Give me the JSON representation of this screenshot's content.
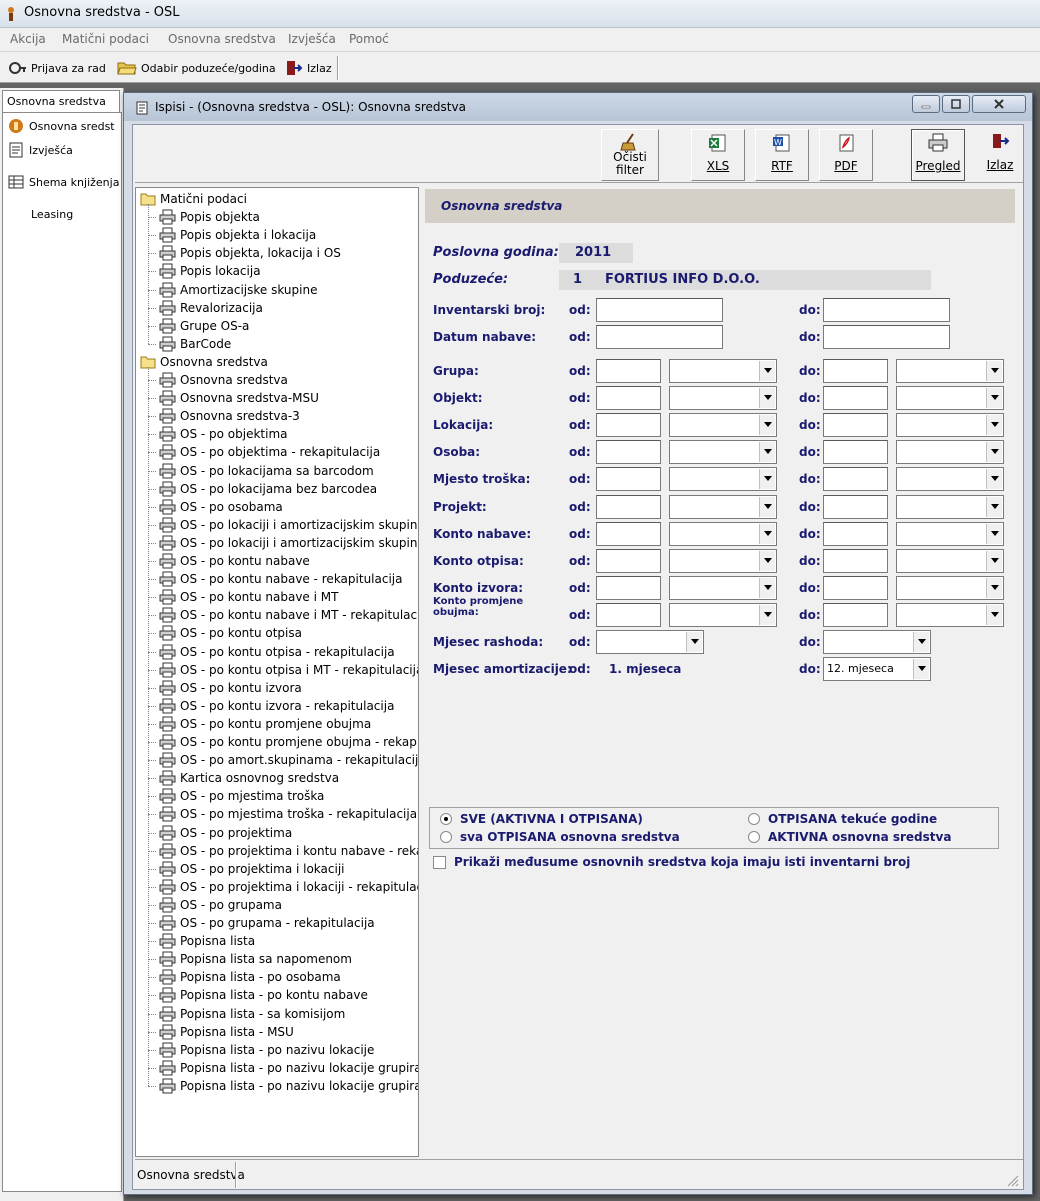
{
  "app": {
    "title": "Osnovna sredstva - OSL"
  },
  "menu": [
    "Akcija",
    "Matični podaci",
    "Osnovna sredstva",
    "Izvješća",
    "Pomoć"
  ],
  "toolbar": {
    "login": "Prijava za rad",
    "select_company": "Odabir poduzeće/godina",
    "exit": "Izlaz"
  },
  "left_panel": {
    "tab": "Osnovna sredstva",
    "items": [
      "Osnovna sredst",
      "Izvješća",
      "Shema knjiženja",
      "Leasing"
    ]
  },
  "dialog": {
    "title": "Ispisi - (Osnovna sredstva - OSL):  Osnovna sredstva",
    "buttons": {
      "clear_filter_1": "Očisti",
      "clear_filter_2": "filter",
      "xls": "XLS",
      "rtf": "RTF",
      "pdf": "PDF",
      "preview": "Pregled",
      "exit": "Izlaz"
    },
    "status": "Osnovna sredstva"
  },
  "tree": {
    "groups": [
      {
        "label": "Matični podaci",
        "items": [
          "Popis objekta",
          "Popis objekta i lokacija",
          "Popis objekta, lokacija i OS",
          "Popis lokacija",
          "Amortizacijske skupine",
          "Revalorizacija",
          "Grupe OS-a",
          "BarCode"
        ]
      },
      {
        "label": "Osnovna sredstva",
        "items": [
          "Osnovna sredstva",
          "Osnovna sredstva-MSU",
          "Osnovna sredstva-3",
          "OS - po objektima",
          "OS - po objektima - rekapitulacija",
          "OS - po lokacijama sa barcodom",
          "OS - po lokacijama bez barcodea",
          "OS - po osobama",
          "OS - po lokaciji i amortizacijskim skupinama",
          "OS - po lokaciji i amortizacijskim skupinama",
          "OS - po kontu nabave",
          "OS - po kontu nabave - rekapitulacija",
          "OS - po kontu nabave i MT",
          "OS - po kontu nabave i MT - rekapitulacija",
          "OS - po kontu otpisa",
          "OS - po kontu otpisa - rekapitulacija",
          "OS - po kontu otpisa i MT - rekapitulacija",
          "OS - po kontu izvora",
          "OS - po kontu izvora - rekapitulacija",
          "OS - po kontu promjene obujma",
          "OS - po kontu promjene obujma - rekapitulacija",
          "OS - po amort.skupinama - rekapitulacija",
          "Kartica osnovnog sredstva",
          "OS - po mjestima troška",
          "OS - po mjestima troška - rekapitulacija",
          "OS - po projektima",
          "OS - po projektima i kontu nabave - rekapitulacija",
          "OS - po projektima i lokaciji",
          "OS - po projektima i lokaciji - rekapitulacija",
          "OS - po grupama",
          "OS - po grupama - rekapitulacija",
          "Popisna lista",
          "Popisna lista sa napomenom",
          "Popisna lista - po osobama",
          "Popisna lista - po kontu nabave",
          "Popisna lista - sa komisijom",
          "Popisna lista - MSU",
          "Popisna lista - po nazivu lokacije",
          "Popisna lista - po nazivu lokacije grupirano",
          "Popisna lista - po nazivu lokacije grupirano -"
        ]
      }
    ]
  },
  "form": {
    "header": "Osnovna sredstva",
    "fiscal_year_label": "Poslovna godina:",
    "fiscal_year": "2011",
    "company_label": "Poduzeće:",
    "company_id": "1",
    "company_name": "FORTIUS INFO D.O.O.",
    "from": "od:",
    "to": "do:",
    "text_rows": [
      "Inventarski broj:",
      "Datum nabave:"
    ],
    "combo_rows": [
      "Grupa:",
      "Objekt:",
      "Lokacija:",
      "Osoba:",
      "Mjesto troška:",
      "Projekt:",
      "Konto nabave:",
      "Konto otpisa:",
      "Konto izvora:"
    ],
    "volume_change_label_1": "Konto promjene",
    "volume_change_label_2": "obujma:",
    "write_off_month_label": "Mjesec rashoda:",
    "depreciation_label": "Mjesec amortizacije:",
    "depreciation_from": "1. mjeseca",
    "depreciation_to": "12. mjeseca",
    "radios": [
      {
        "label": "SVE (AKTIVNA I OTPISANA)",
        "checked": true
      },
      {
        "label": "OTPISANA tekuće godine",
        "checked": false
      },
      {
        "label": "sva OTPISANA osnovna sredstva",
        "checked": false
      },
      {
        "label": "AKTIVNA osnovna sredstva",
        "checked": false
      }
    ],
    "checkbox_label": "Prikaži međusume osnovnih sredstva koja imaju isti inventarni broj",
    "checkbox_checked": false
  }
}
